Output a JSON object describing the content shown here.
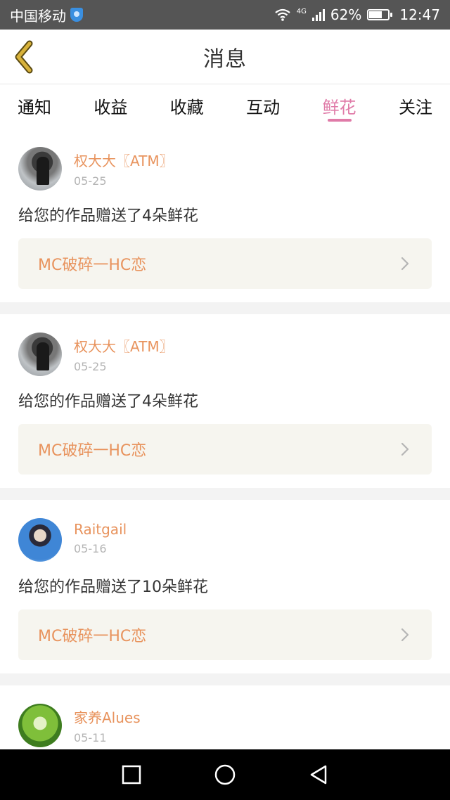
{
  "status_bar": {
    "carrier": "中国移动",
    "network": "4G",
    "battery": "62%",
    "time": "12:47"
  },
  "header": {
    "title": "消息"
  },
  "tabs": [
    {
      "label": "通知",
      "active": false
    },
    {
      "label": "收益",
      "active": false
    },
    {
      "label": "收藏",
      "active": false
    },
    {
      "label": "互动",
      "active": false
    },
    {
      "label": "鲜花",
      "active": true
    },
    {
      "label": "关注",
      "active": false
    }
  ],
  "messages": [
    {
      "username": "权大大〖ATM〗",
      "date": "05-25",
      "text": "给您的作品赠送了4朵鲜花",
      "work": "MC破碎一HC恋"
    },
    {
      "username": "权大大〖ATM〗",
      "date": "05-25",
      "text": "给您的作品赠送了4朵鲜花",
      "work": "MC破碎一HC恋"
    },
    {
      "username": "Raitgail",
      "date": "05-16",
      "text": "给您的作品赠送了10朵鲜花",
      "work": "MC破碎一HC恋"
    },
    {
      "username": "家养Alues",
      "date": "05-11",
      "text": "",
      "work": ""
    }
  ],
  "colors": {
    "accent_pink": "#e07ba8",
    "username_orange": "#e8935d",
    "back_arrow": "#c9a227"
  }
}
